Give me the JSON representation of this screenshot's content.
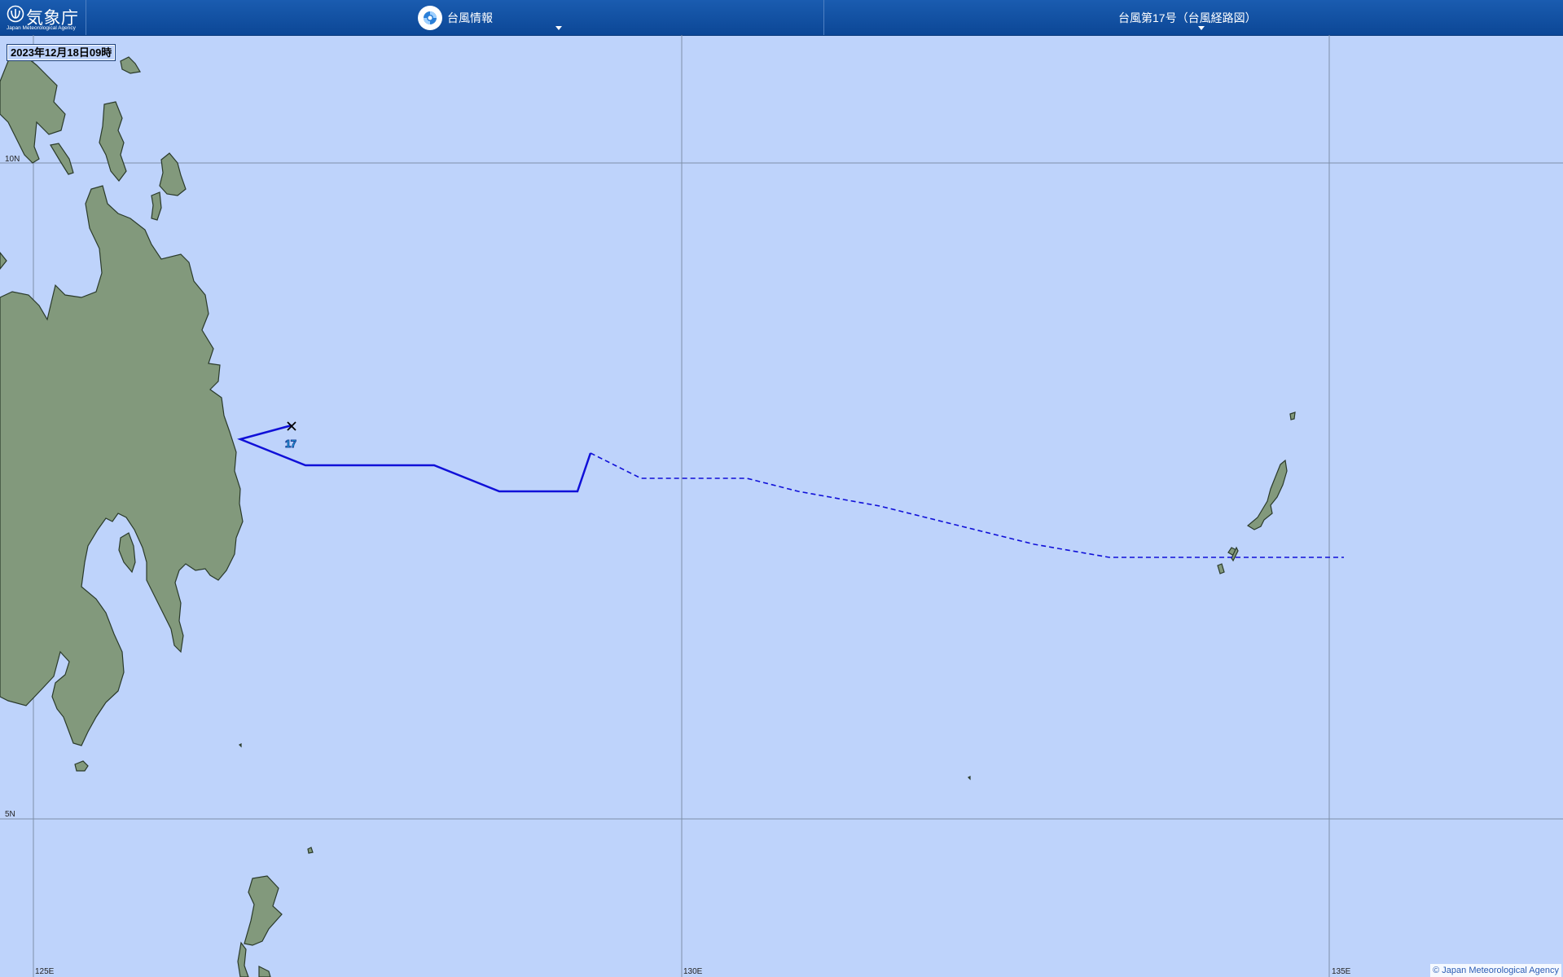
{
  "header": {
    "logo_text_jp": "気象庁",
    "logo_text_en": "Japan Meteorological Agency",
    "menu_typhoon_info": "台風情報",
    "menu_track_title": "台風第17号（台風経路図）"
  },
  "map": {
    "timestamp": "2023年12月18日09時",
    "lat_labels": [
      "10N",
      "5N"
    ],
    "lon_labels": [
      "125E",
      "130E",
      "135E"
    ],
    "typhoon_number": "17",
    "copyright": "© Japan Meteorological Agency",
    "colors": {
      "sea": "#bed3fb",
      "land": "#82997c",
      "track_observed": "#1010d8",
      "track_forecast": "#1010d8",
      "header": "#0c4796"
    },
    "track": {
      "observed_style": "solid",
      "forecast_style": "dashed",
      "current_position_marker": "×"
    }
  }
}
